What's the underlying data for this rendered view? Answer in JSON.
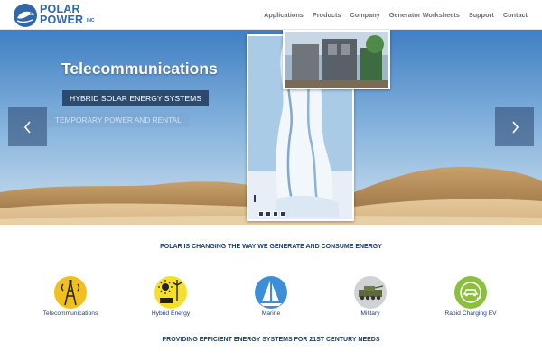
{
  "brand": {
    "line1": "POLAR",
    "line2": "POWER",
    "suffix": "INC"
  },
  "nav": {
    "items": [
      {
        "label": "Applications"
      },
      {
        "label": "Products"
      },
      {
        "label": "Company"
      },
      {
        "label": "Generator Worksheets"
      },
      {
        "label": "Support"
      },
      {
        "label": "Contact"
      }
    ]
  },
  "hero": {
    "title": "Telecommunications",
    "badge": "HYBRID SOLAR ENERGY SYSTEMS",
    "badge_secondary": "TEMPORARY POWER AND RENTAL",
    "slide_count": 4
  },
  "main": {
    "tagline": "POLAR IS CHANGING THE WAY WE GENERATE AND CONSUME ENERGY",
    "features": [
      {
        "label": "Telecommunications",
        "icon": "cell-tower-icon",
        "color": "#f2c01e"
      },
      {
        "label": "Hybrid Energy",
        "icon": "solar-wind-icon",
        "color": "#f4df2a"
      },
      {
        "label": "Marine",
        "icon": "sailboat-icon",
        "color": "#3d8ed8"
      },
      {
        "label": "Military",
        "icon": "armored-vehicle-icon",
        "color": "#cfd3d6"
      },
      {
        "label": "Rapid Charging EV",
        "icon": "ev-charging-icon",
        "color": "#8dbf3f"
      }
    ],
    "tagline2": "PROVIDING EFFICIENT ENERGY SYSTEMS FOR 21ST CENTURY NEEDS"
  },
  "colors": {
    "brand": "#2f67a8",
    "navy": "#1d3f6e",
    "badge": "#2b4a6d"
  }
}
